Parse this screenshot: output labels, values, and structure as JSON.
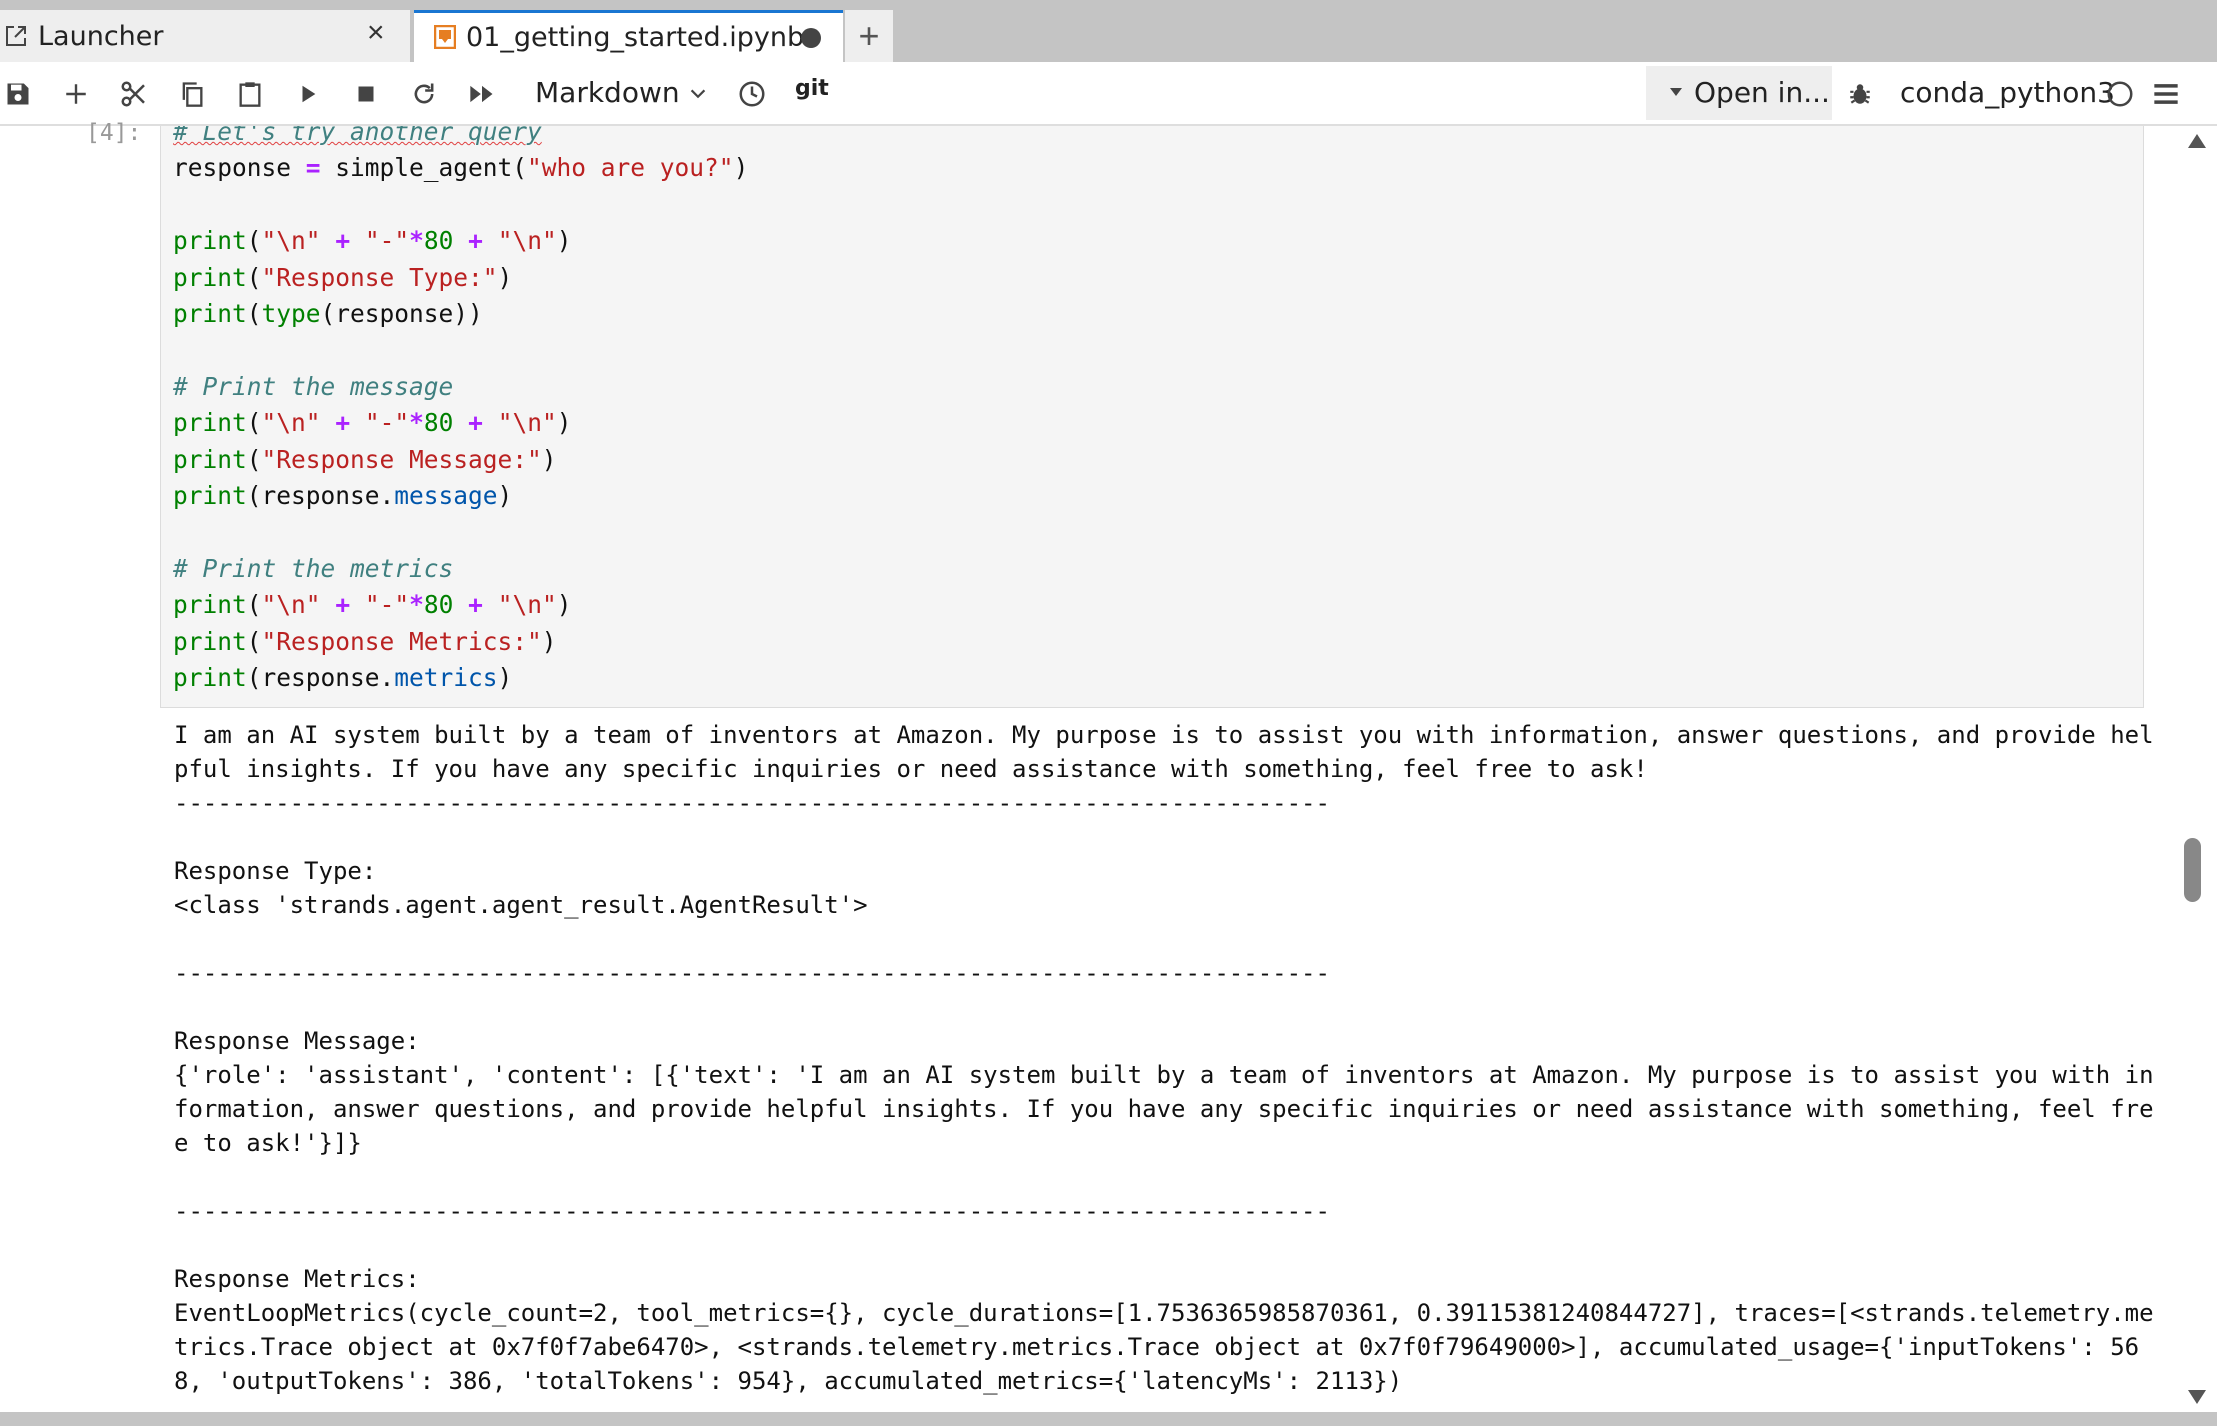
{
  "tabs": [
    {
      "label": "Launcher",
      "icon": "external-launch-icon",
      "close": "×"
    },
    {
      "label": "01_getting_started.ipynb",
      "icon": "notebook-icon",
      "status": "unsaved-dot"
    }
  ],
  "new_tab_label": "+",
  "toolbar": {
    "cell_type": "Markdown",
    "git_label": "git",
    "open_in_label": "Open in...",
    "kernel_name": "conda_python3",
    "icons": [
      "save-icon",
      "add-cell-icon",
      "cut-icon",
      "copy-icon",
      "paste-icon",
      "run-icon",
      "stop-icon",
      "restart-icon",
      "run-all-icon",
      "clock-icon",
      "bug-icon",
      "kernel-status-icon",
      "menu-icon"
    ]
  },
  "cell": {
    "prompt": "[4]:",
    "code_lines": [
      "# Let's try another query",
      "response = simple_agent(\"who are you?\")",
      "",
      "print(\"\\n\" + \"-\"*80 + \"\\n\")",
      "print(\"Response Type:\")",
      "print(type(response))",
      "",
      "# Print the message",
      "print(\"\\n\" + \"-\"*80 + \"\\n\")",
      "print(\"Response Message:\")",
      "print(response.message)",
      "",
      "# Print the metrics",
      "print(\"\\n\" + \"-\"*80 + \"\\n\")",
      "print(\"Response Metrics:\")",
      "print(response.metrics)"
    ]
  },
  "output": {
    "text": "I am an AI system built by a team of inventors at Amazon. My purpose is to assist you with information, answer questions, and provide hel\npful insights. If you have any specific inquiries or need assistance with something, feel free to ask!\n--------------------------------------------------------------------------------\n\nResponse Type:\n<class 'strands.agent.agent_result.AgentResult'>\n\n--------------------------------------------------------------------------------\n\nResponse Message:\n{'role': 'assistant', 'content': [{'text': 'I am an AI system built by a team of inventors at Amazon. My purpose is to assist you with in\nformation, answer questions, and provide helpful insights. If you have any specific inquiries or need assistance with something, feel fre\ne to ask!'}]}\n\n--------------------------------------------------------------------------------\n\nResponse Metrics:\nEventLoopMetrics(cycle_count=2, tool_metrics={}, cycle_durations=[1.7536365985870361, 0.39115381240844727], traces=[<strands.telemetry.me\ntrics.Trace object at 0x7f0f7abe6470>, <strands.telemetry.metrics.Trace object at 0x7f0f79649000>], accumulated_usage={'inputTokens': 56\n8, 'outputTokens': 386, 'totalTokens': 954}, accumulated_metrics={'latencyMs': 2113})"
  },
  "colors": {
    "active_tab_accent": "#1976d2",
    "notebook_icon": "#e67e22",
    "code_background": "#f5f5f5",
    "string": "#ba2121",
    "builtin": "#008000",
    "operator": "#aa22ff",
    "comment": "#408080"
  }
}
